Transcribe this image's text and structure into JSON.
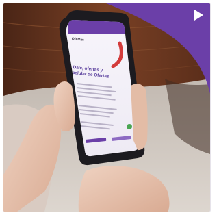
{
  "image": {
    "description": "Hands holding a smartphone showing a purple mobile web page, with a purple corner shape and a white play symbol",
    "icons": [
      "play-icon"
    ],
    "colors": {
      "brand_purple": "#6b3fa8",
      "accent_red": "#d33b3b",
      "wood": "#6b3a22"
    }
  },
  "phone": {
    "screen": {
      "header_label": "Ofertas",
      "headline": "Dale, ofertas y celular de Ofertas"
    }
  }
}
